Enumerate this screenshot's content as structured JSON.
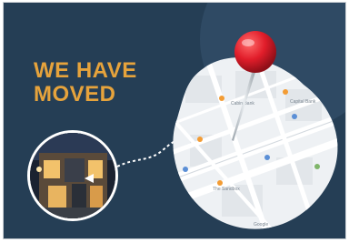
{
  "headline": {
    "line1": "WE HAVE",
    "line2": "MOVED"
  },
  "map": {
    "labels": [
      {
        "name": "map-label-1",
        "text": "Cabin Bank"
      },
      {
        "name": "map-label-2",
        "text": "Capital Bank"
      },
      {
        "name": "map-label-3",
        "text": "The Sandbox"
      },
      {
        "name": "map-label-4",
        "text": "Google"
      }
    ]
  },
  "colors": {
    "background": "#253e55",
    "accent": "#e6a33c",
    "pin": "#e11d2a",
    "map": "#eef1f4"
  },
  "icons": [
    "map-pin-icon",
    "arrow-icon"
  ]
}
